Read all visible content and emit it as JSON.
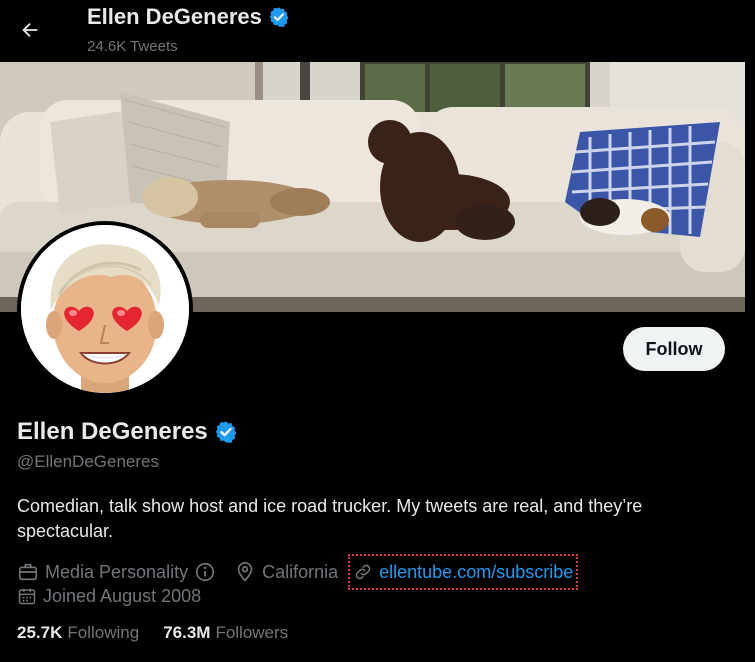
{
  "header": {
    "back_icon": "arrow-left-icon",
    "name": "Ellen DeGeneres",
    "tweet_count": "24.6K Tweets"
  },
  "profile": {
    "name": "Ellen DeGeneres",
    "verified_icon": "verified-badge-icon",
    "handle": "@EllenDeGeneres",
    "bio": "Comedian, talk show host and ice road trucker. My tweets are real, and they’re spectacular.",
    "follow_label": "Follow"
  },
  "meta": {
    "category": "Media Personality",
    "location": "California",
    "link": "ellentube.com/subscribe",
    "joined": "Joined August 2008"
  },
  "stats": {
    "following_count": "25.7K",
    "following_label": "Following",
    "followers_count": "76.3M",
    "followers_label": "Followers"
  },
  "colors": {
    "background": "#000000",
    "accent": "#1d9bf0",
    "muted": "#71767b",
    "text": "#e7e9ea",
    "highlight_box": "#e0393c"
  }
}
